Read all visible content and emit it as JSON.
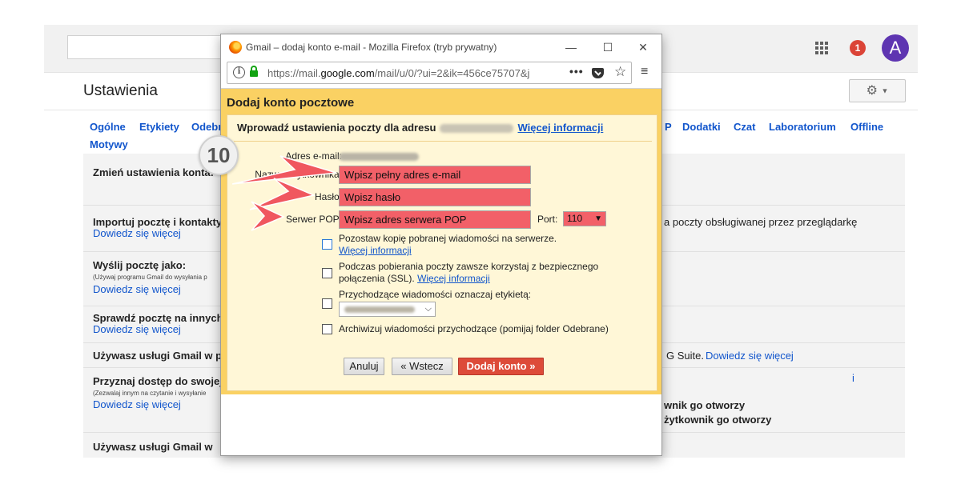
{
  "gmail": {
    "notif_count": "1",
    "avatar_letter": "A",
    "page_title": "Ustawienia",
    "tabs_left": [
      "Ogólne",
      "Etykiety",
      "Odebr"
    ],
    "tabs_right": [
      "P",
      "Dodatki",
      "Czat",
      "Laboratorium",
      "Offline"
    ],
    "tab_second_row": "Motywy",
    "rows": [
      {
        "label": "Zmień ustawienia konta:",
        "small": "",
        "link": ""
      },
      {
        "label": "Importuj pocztę i kontakty",
        "small": "",
        "link": "Dowiedz się więcej"
      },
      {
        "label": "Wyślij pocztę jako:",
        "small": "(Używaj programu Gmail do wysyłania p",
        "link": "Dowiedz się więcej"
      },
      {
        "label": "Sprawdź pocztę na innych",
        "small": "",
        "link": "Dowiedz się więcej"
      },
      {
        "label": "Używasz usługi Gmail w p",
        "small": "",
        "link": ""
      },
      {
        "label": "Przyznaj dostęp do swojej",
        "small": "(Zezwalaj innym na czytanie i wysyłanie",
        "link": "Dowiedz się więcej"
      },
      {
        "label": "Używasz usługi Gmail w",
        "small": "",
        "link": ""
      }
    ],
    "right_text_1": "a poczty obsługiwanej przez przeglądarkę",
    "right_text_2": "G Suite.",
    "right_link_2": "Dowiedz się więcej",
    "right_text_3": "i",
    "right_text_4": "wnik go otworzy",
    "right_text_5": "żytkownik go otworzy"
  },
  "popup": {
    "window_title": "Gmail – dodaj konto e-mail - Mozilla Firefox (tryb prywatny)",
    "url_prefix": "https://mail.",
    "url_domain": "google.com",
    "url_rest": "/mail/u/0/?ui=2&ik=456ce75707&j",
    "controls": {
      "minimize": "—",
      "maximize": "☐",
      "close": "✕",
      "menu": "≡",
      "more": "•••",
      "star": "☆"
    },
    "dialog_title": "Dodaj konto pocztowe",
    "heading": "Wprowadź ustawienia poczty dla adresu",
    "heading_link": "Więcej informacji",
    "label_email": "Adres e-mail:",
    "label_username": "Nazwa użytkownika:",
    "value_username": "Wpisz pełny adres e-mail",
    "label_password": "Hasło:",
    "value_password": "Wpisz hasło",
    "label_pop": "Serwer POP:",
    "value_pop": "Wpisz adres serwera POP",
    "label_port": "Port:",
    "value_port": "110",
    "option1": "Pozostaw kopię pobranej wiadomości na serwerze.",
    "option1_link": "Więcej informacji",
    "option2a": "Podczas pobierania poczty zawsze korzystaj z bezpiecznego",
    "option2b": "połączenia (SSL).",
    "option2_link": "Więcej informacji",
    "option3": "Przychodzące wiadomości oznaczaj etykietą:",
    "option4": "Archiwizuj wiadomości przychodzące (pomijaj folder Odebrane)",
    "btn_cancel": "Anuluj",
    "btn_back": "« Wstecz",
    "btn_add": "Dodaj konto »"
  },
  "annotation": {
    "step_number": "10",
    "arrow_color": "#f0575f"
  }
}
